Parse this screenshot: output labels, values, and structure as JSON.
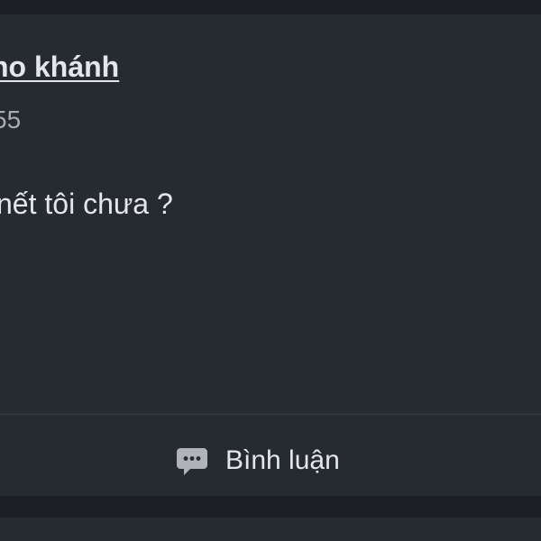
{
  "post": {
    "author_name": "no khánh",
    "time": "55",
    "content": "nết tôi chưa ?"
  },
  "actions": {
    "comment_label": "Bình luận",
    "comment_icon": "comment-icon"
  },
  "colors": {
    "background": "#1c2025",
    "card": "#262a31",
    "text": "#e4e6eb",
    "muted_text": "#a8abb0",
    "icon": "#b0b3b8"
  }
}
